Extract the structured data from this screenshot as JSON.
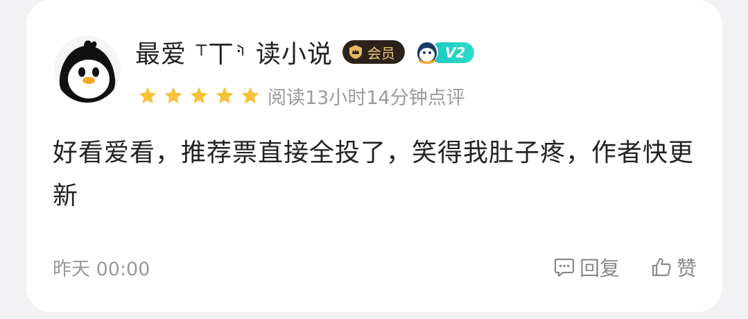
{
  "comment": {
    "user": {
      "nickname": "最爱 ⸆丅⸅ 读小说",
      "avatar_icon": "penguin-avatar-icon",
      "vip_badge": {
        "icon": "crown-shield-icon",
        "label": "会员",
        "color": "#2b231b",
        "text_color": "#f0c87c"
      },
      "level_badge": {
        "icon": "penguin-level-icon",
        "label": "V2",
        "color": "#1fcfc4"
      }
    },
    "rating": {
      "stars": 5,
      "max_stars": 5,
      "star_color": "#f8c13a",
      "text": "阅读13小时14分钟点评"
    },
    "content": "好看爱看，推荐票直接全投了，笑得我肚子疼，作者快更新",
    "timestamp": "昨天 00:00",
    "actions": {
      "reply": {
        "icon": "comment-icon",
        "label": "回复"
      },
      "like": {
        "icon": "thumbs-up-icon",
        "label": "赞"
      }
    }
  }
}
